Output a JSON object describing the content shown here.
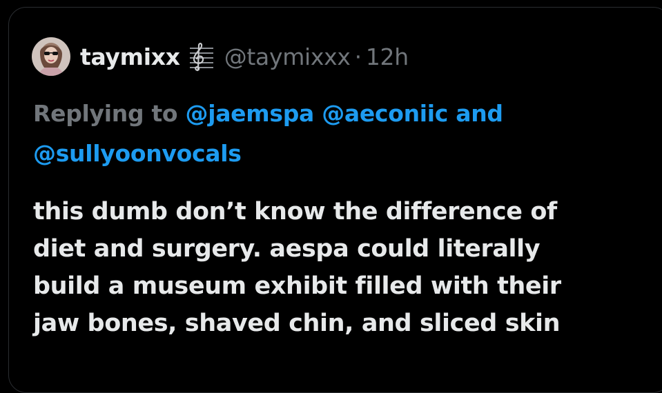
{
  "tweet": {
    "author": {
      "display_name": "taymixx",
      "badge_icon": "treble-clef-music-staff-icon",
      "handle": "@taymixxx",
      "separator": "·",
      "timestamp": "12h"
    },
    "reply": {
      "prefix": "Replying to ",
      "mentions": [
        "@jaemspa",
        "@aeconiic"
      ],
      "conjunction": " and",
      "last_mention": "@sullyoonvocals"
    },
    "text_lines": [
      "this dumb don’t know the difference of",
      "diet and surgery. aespa could literally",
      "build a museum exhibit filled with their",
      "jaw bones, shaved chin, and sliced skin"
    ]
  },
  "colors": {
    "background": "#000000",
    "text_primary": "#e7e9ea",
    "text_secondary": "#71767b",
    "link": "#1d9bf0"
  }
}
